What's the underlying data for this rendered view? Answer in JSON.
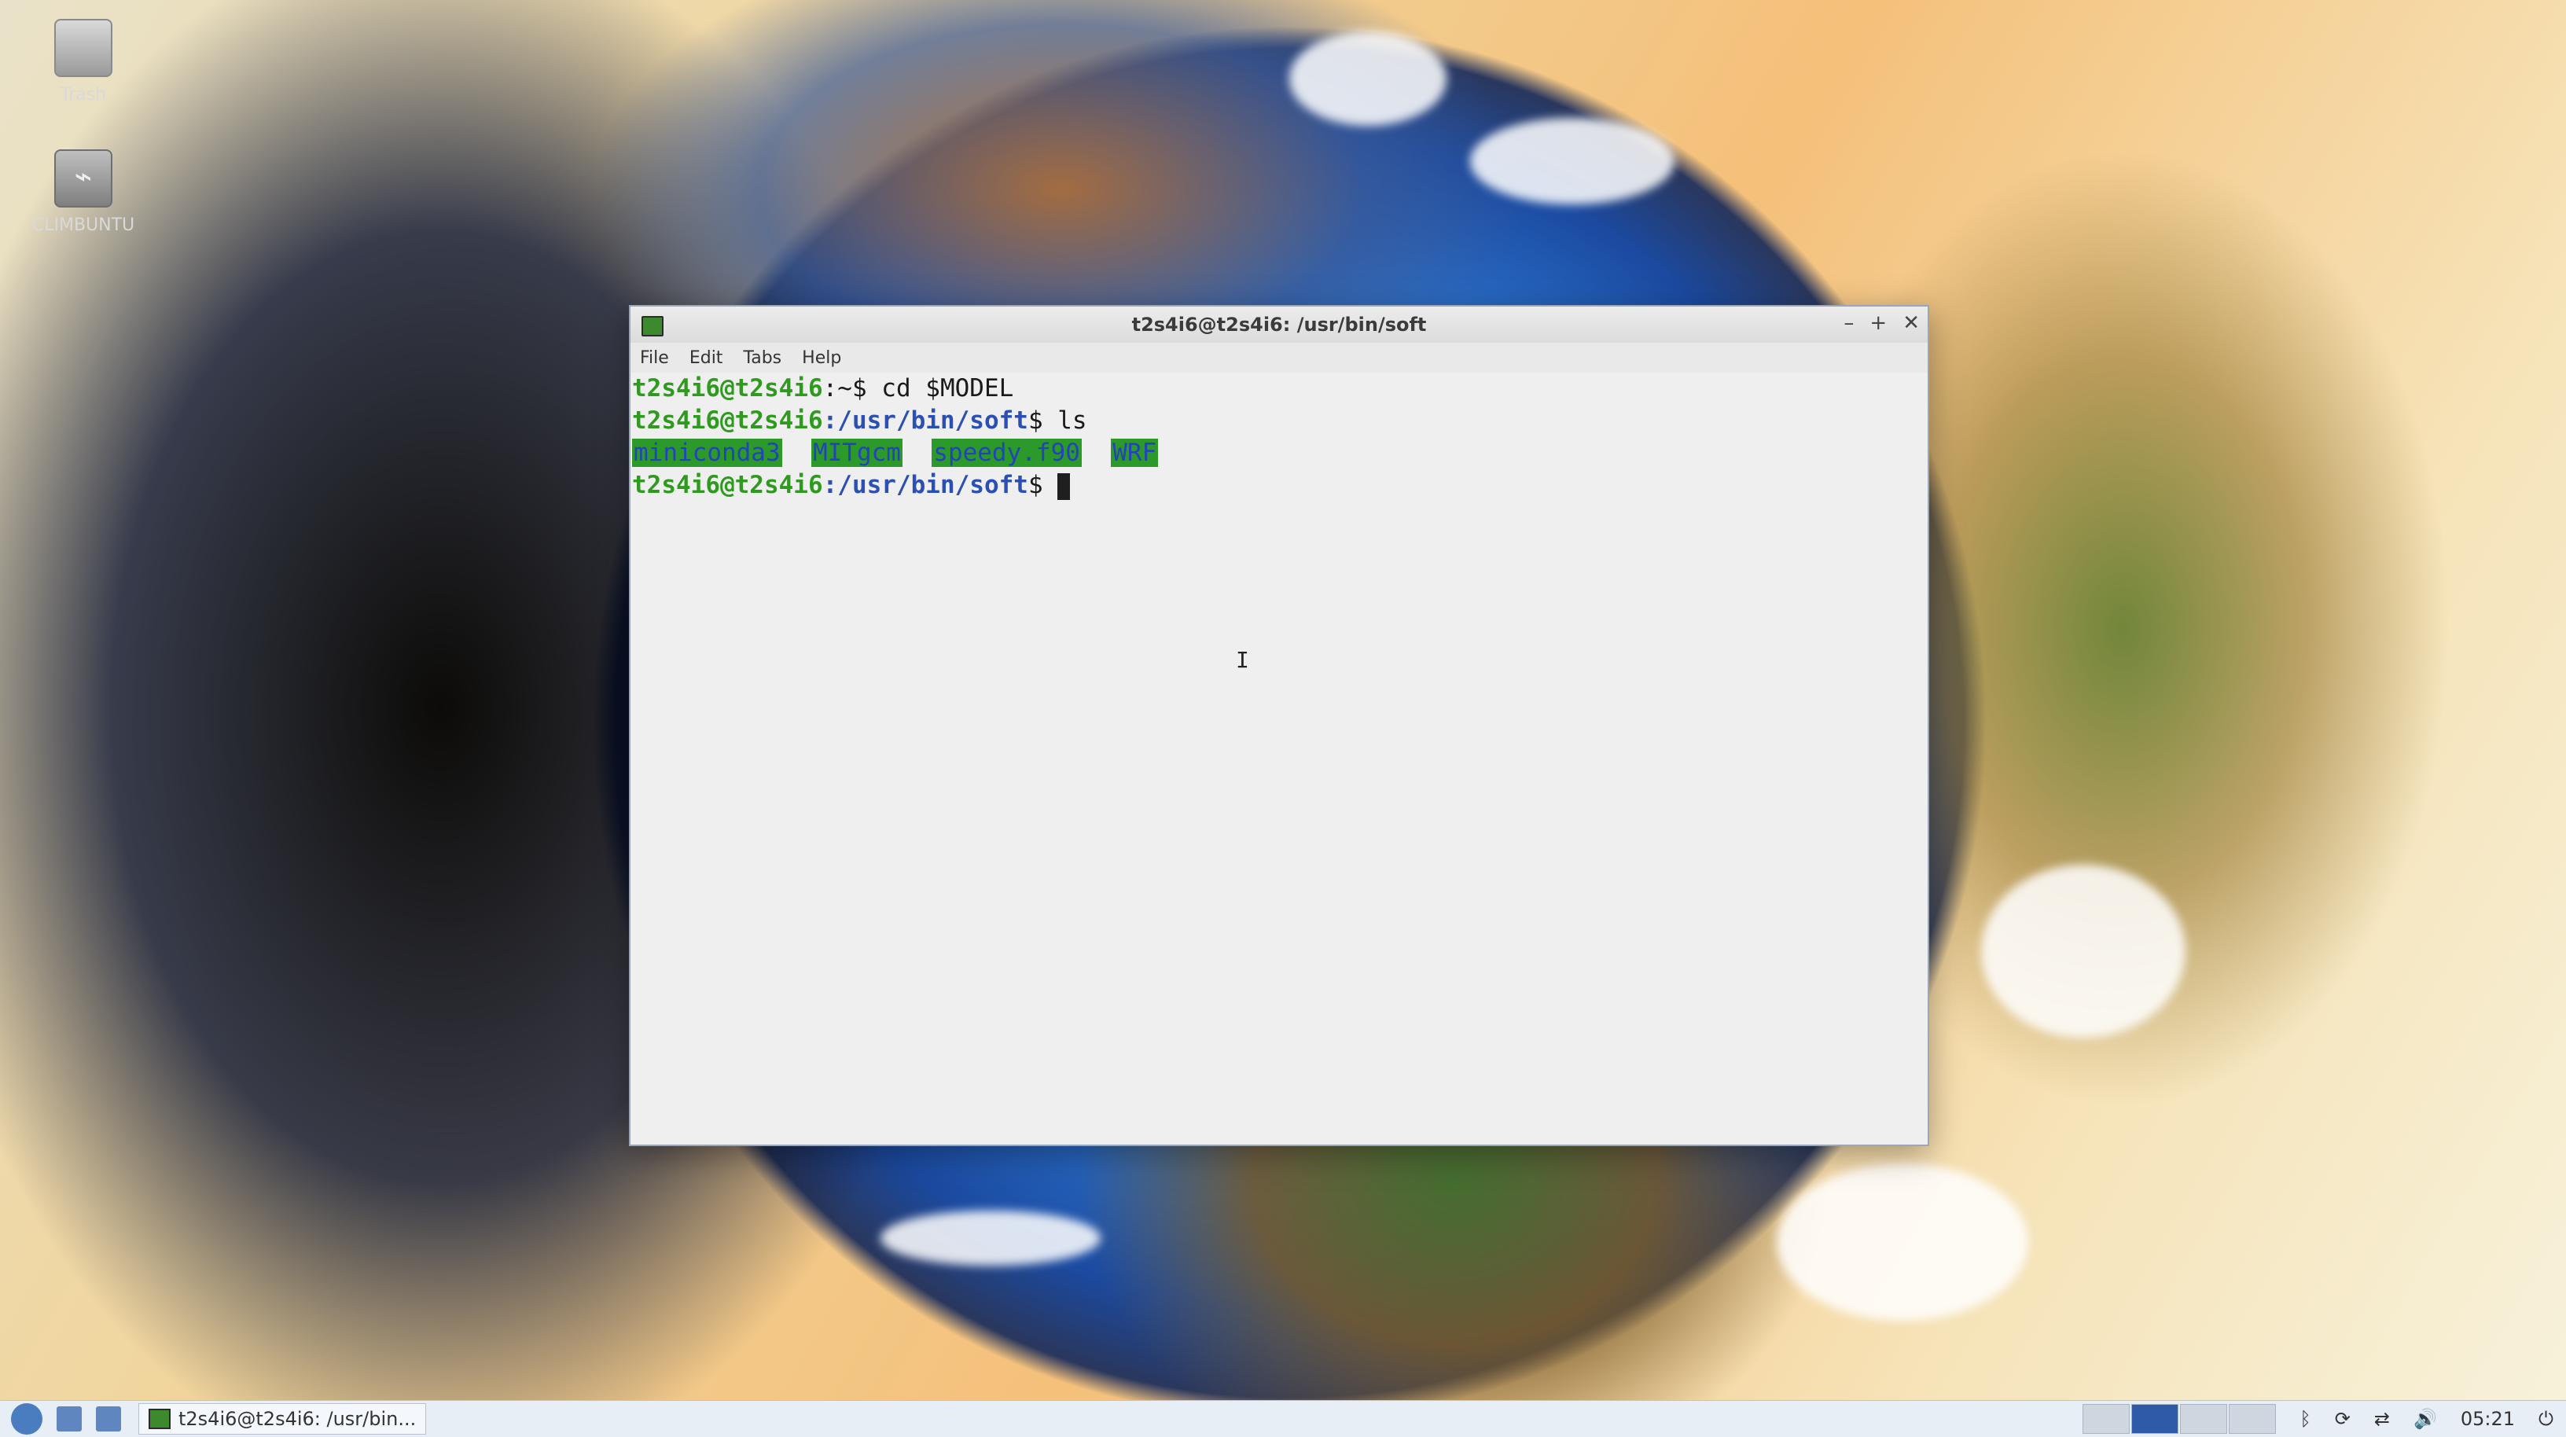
{
  "desktop": {
    "icons": [
      {
        "label": "Trash"
      },
      {
        "label": "CLIMBUNTU"
      }
    ]
  },
  "window": {
    "title": "t2s4i6@t2s4i6: /usr/bin/soft",
    "controls": {
      "minimize": "–",
      "maximize": "+",
      "close": "✕"
    },
    "menu": [
      "File",
      "Edit",
      "Tabs",
      "Help"
    ]
  },
  "terminal": {
    "lines": [
      {
        "user": "t2s4i6@t2s4i6",
        "path": ":~",
        "prompt": "$ ",
        "cmd": "cd $MODEL"
      },
      {
        "user": "t2s4i6@t2s4i6",
        "path": ":/usr/bin/soft",
        "prompt": "$ ",
        "cmd": "ls"
      },
      {
        "dirs": [
          "miniconda3",
          "MITgcm",
          "speedy.f90",
          "WRF"
        ]
      },
      {
        "user": "t2s4i6@t2s4i6",
        "path": ":/usr/bin/soft",
        "prompt": "$ ",
        "cmd": ""
      }
    ]
  },
  "taskbar": {
    "task_label": "t2s4i6@t2s4i6: /usr/bin...",
    "clock": "05:21"
  },
  "colors": {
    "prompt_user": "#2f9a1f",
    "prompt_path": "#2b4fb3",
    "dir_bg": "#2c9a2a",
    "dir_fg": "#2344b8"
  }
}
